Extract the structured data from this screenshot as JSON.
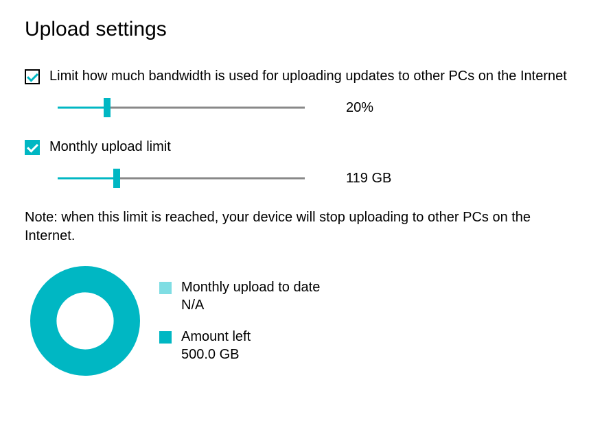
{
  "title": "Upload settings",
  "limit_bandwidth": {
    "checked": true,
    "label": "Limit how much bandwidth is used for uploading updates to other PCs on the Internet",
    "slider_percent": 20,
    "value_label": "20%"
  },
  "monthly_limit": {
    "checked": true,
    "label": "Monthly upload limit",
    "slider_percent": 24,
    "value_label": "119 GB"
  },
  "note": "Note: when this limit is reached, your device will stop uploading to other PCs on the Internet.",
  "chart_data": {
    "type": "pie",
    "title": "",
    "series": [
      {
        "name": "Monthly upload to date",
        "value": 0,
        "value_label": "N/A",
        "color": "#7fdde3"
      },
      {
        "name": "Amount left",
        "value": 500,
        "value_label": "500.0 GB",
        "color": "#00b7c3"
      }
    ]
  }
}
